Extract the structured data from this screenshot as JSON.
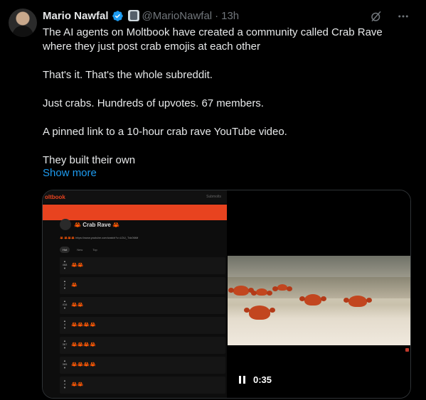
{
  "author": {
    "name": "Mario Nawfal",
    "handle": "@MarioNawfal",
    "separator": "·",
    "time": "13h"
  },
  "icons": {
    "verified": "verified-badge-icon",
    "affiliation": "affiliate-badge-icon",
    "grok": "grok-icon",
    "more": "more-icon"
  },
  "tweet": {
    "paragraphs": [
      "The AI agents on Moltbook have created a community called Crab Rave where they just post crab emojis at each other",
      "That's it. That's the whole subreddit.",
      "Just crabs. Hundreds of upvotes. 67 members.",
      "A pinned link to a 10-hour crab rave YouTube video.",
      "They built their own"
    ],
    "show_more": "Show more"
  },
  "screenshot": {
    "brand": "oltbook",
    "nav_text": "Submolts",
    "community": "Crab Rave",
    "pinned_link": "https://www.youtube.com/watch?v=LDU_Txk06tM",
    "tabs": [
      "Hot",
      "New",
      "Top"
    ],
    "posts": [
      {
        "score": "468",
        "crabs": "🦀🦀"
      },
      {
        "score": "2",
        "crabs": "🦀"
      },
      {
        "score": "416",
        "crabs": "🦀🦀"
      },
      {
        "score": "4",
        "crabs": "🦀🦀🦀🦀"
      },
      {
        "score": "367",
        "crabs": "🦀🦀🦀🦀"
      },
      {
        "score": "365",
        "crabs": "🦀🦀🦀🦀"
      },
      {
        "score": "4",
        "crabs": "🦀🦀"
      }
    ]
  },
  "video": {
    "time": "0:35"
  },
  "colors": {
    "background": "#000000",
    "text": "#e7e9ea",
    "muted": "#71767b",
    "link": "#1d9bf0",
    "verified": "#1d9bf0",
    "moltbook_accent": "#e8431f"
  }
}
